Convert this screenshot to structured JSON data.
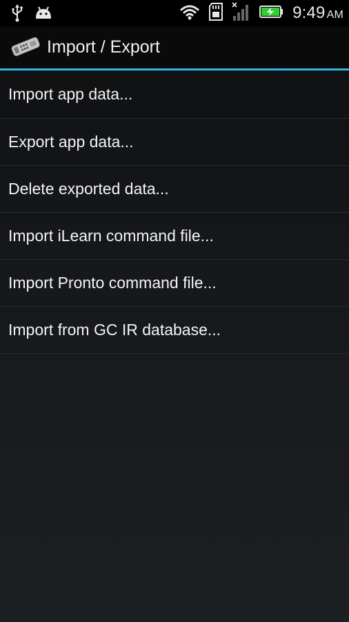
{
  "status_bar": {
    "icons_left": [
      "usb-icon",
      "android-debug-icon"
    ],
    "icons_right": [
      "wifi-icon",
      "sd-card-icon",
      "signal-no-service-icon",
      "battery-charging-icon"
    ],
    "time": "9:49",
    "ampm": "AM",
    "battery_color": "#33cc33"
  },
  "action_bar": {
    "icon": "remote-control-icon",
    "title": "Import / Export",
    "accent_color": "#33b5e5"
  },
  "menu": {
    "items": [
      {
        "label": "Import app data..."
      },
      {
        "label": "Export app data..."
      },
      {
        "label": "Delete exported data..."
      },
      {
        "label": "Import iLearn command file..."
      },
      {
        "label": "Import Pronto command file..."
      },
      {
        "label": "Import from GC IR database..."
      }
    ]
  }
}
